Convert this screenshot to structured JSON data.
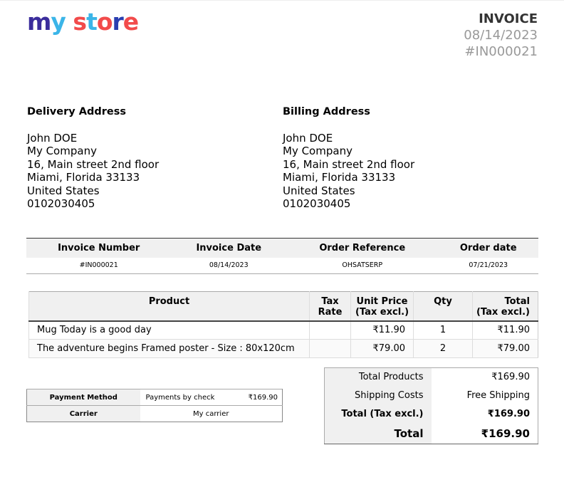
{
  "logo": {
    "text": "my store",
    "letters": [
      {
        "c": "m",
        "color": "#3b2d9c"
      },
      {
        "c": "y",
        "color": "#3bb5e8"
      },
      {
        "c": " ",
        "color": "#000"
      },
      {
        "c": "s",
        "color": "#f24b4b"
      },
      {
        "c": "t",
        "color": "#3bb5e8"
      },
      {
        "c": "o",
        "color": "#f24b4b"
      },
      {
        "c": "r",
        "color": "#2a3fb0"
      },
      {
        "c": "e",
        "color": "#f24b4b"
      }
    ]
  },
  "header": {
    "title": "INVOICE",
    "date": "08/14/2023",
    "number": "#IN000021"
  },
  "delivery": {
    "heading": "Delivery Address",
    "lines": [
      "John DOE",
      "My Company",
      "16, Main street 2nd floor",
      "Miami, Florida 33133",
      "United States",
      "0102030405"
    ]
  },
  "billing": {
    "heading": "Billing Address",
    "lines": [
      "John DOE",
      "My Company",
      "16, Main street 2nd floor",
      "Miami, Florida 33133",
      "United States",
      "0102030405"
    ]
  },
  "info": {
    "headers": [
      "Invoice Number",
      "Invoice Date",
      "Order Reference",
      "Order date"
    ],
    "values": [
      "#IN000021",
      "08/14/2023",
      "OHSATSERP",
      "07/21/2023"
    ]
  },
  "products": {
    "headers": {
      "product": "Product",
      "tax1": "Tax",
      "tax2": "Rate",
      "unit1": "Unit Price",
      "unit2": "(Tax excl.)",
      "qty": "Qty",
      "total1": "Total",
      "total2": "(Tax excl.)"
    },
    "rows": [
      {
        "name": "Mug Today is a good day",
        "tax": "",
        "unit": "₹11.90",
        "qty": "1",
        "total": "₹11.90"
      },
      {
        "name": "The adventure begins Framed poster - Size : 80x120cm",
        "tax": "",
        "unit": "₹79.00",
        "qty": "2",
        "total": "₹79.00"
      }
    ]
  },
  "payment": {
    "method_label": "Payment Method",
    "method": "Payments by check",
    "amount": "₹169.90",
    "carrier_label": "Carrier",
    "carrier": "My carrier"
  },
  "totals": {
    "products_label": "Total Products",
    "products": "₹169.90",
    "shipping_label": "Shipping Costs",
    "shipping": "Free Shipping",
    "tax_excl_label": "Total (Tax excl.)",
    "tax_excl": "₹169.90",
    "total_label": "Total",
    "total": "₹169.90"
  }
}
